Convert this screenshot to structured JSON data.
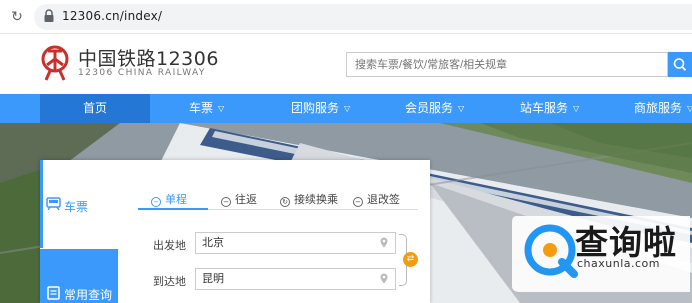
{
  "browser": {
    "url": "12306.cn/index/"
  },
  "site": {
    "logo_cn": "中国铁路12306",
    "logo_en": "12306 CHINA RAILWAY",
    "search_placeholder": "搜索车票/餐饮/常旅客/相关规章"
  },
  "nav": {
    "items": [
      {
        "label": "首页",
        "dropdown": false
      },
      {
        "label": "车票",
        "dropdown": true
      },
      {
        "label": "团购服务",
        "dropdown": true
      },
      {
        "label": "会员服务",
        "dropdown": true
      },
      {
        "label": "站车服务",
        "dropdown": true
      },
      {
        "label": "商旅服务",
        "dropdown": true
      }
    ]
  },
  "panel": {
    "side": {
      "ticket": "车票",
      "common": "常用查询"
    },
    "tabs": [
      {
        "label": "单程",
        "icon": "minus-circle-icon"
      },
      {
        "label": "往返",
        "icon": "minus-circle-icon"
      },
      {
        "label": "接续换乘",
        "icon": "refresh-circle-icon"
      },
      {
        "label": "退改签",
        "icon": "minus-circle-icon"
      }
    ],
    "from_label": "出发地",
    "from_value": "北京",
    "to_label": "到达地",
    "to_value": "昆明"
  },
  "watermark": {
    "cn": "查询啦",
    "en": "chaxunla.com"
  },
  "colors": {
    "brand_blue": "#3b99fc",
    "nav_active": "#2577d6",
    "swap_orange": "#f39c12",
    "logo_red": "#c9302c"
  }
}
